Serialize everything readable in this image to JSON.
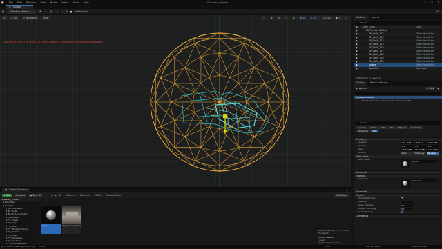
{
  "menubar": {
    "items": [
      "File",
      "Edit",
      "Window",
      "Tools",
      "Build",
      "Select",
      "Actor",
      "Help"
    ],
    "project": "Shadows_Project"
  },
  "level_tab": "FX_Funkbot",
  "toolbar": {
    "mode": "Selection Mode",
    "platforms": "Platforms"
  },
  "viewport": {
    "view": "Top",
    "shading": "Wireframe",
    "show": "Show",
    "warning": "LIGHTING NEEDS TO BE REBUILT (1 unbuilt object(s))  'DisableAllScreenMessages' to suppress",
    "grid": "10",
    "angle": "10°",
    "scale": "0.25",
    "cam": "4"
  },
  "outliner": {
    "tabs": [
      "Outliner",
      "Layers"
    ],
    "search": "Search...",
    "col_label": "Item Label",
    "col_type": "Type",
    "rows": [
      {
        "label": "FX_Funkbot (Editor)",
        "type": "",
        "sel": false
      },
      {
        "label": "SM_Walls_112",
        "type": "StaticMeshActor",
        "sel": false
      },
      {
        "label": "SM_Walls_113",
        "type": "StaticMeshActor",
        "sel": false
      },
      {
        "label": "SM_Walls_114",
        "type": "StaticMeshActor",
        "sel": false
      },
      {
        "label": "SM_Walls_115",
        "type": "StaticMeshActor",
        "sel": false
      },
      {
        "label": "SM_Walls_116",
        "type": "StaticMeshActor",
        "sel": false
      },
      {
        "label": "SM_Walls_117",
        "type": "StaticMeshActor",
        "sel": false
      },
      {
        "label": "SM_Walls_118",
        "type": "StaticMeshActor",
        "sel": false
      },
      {
        "label": "SM_Walls_119",
        "type": "StaticMeshActor",
        "sel": false
      },
      {
        "label": "SM_Walls_120",
        "type": "StaticMeshActor",
        "sel": false
      },
      {
        "label": "sphere",
        "type": "StaticMeshActor",
        "sel": true
      },
      {
        "label": "SpotLight",
        "type": "SpotLight",
        "sel": false
      }
    ],
    "footer": "1,586 actors (1 selected)"
  },
  "details": {
    "tabs": [
      "Details",
      "World Settings"
    ],
    "actor": "sphere",
    "add": "+ Add",
    "component_root": "sphere (Instance)",
    "component": "StaticMeshComponent (StaticMeshComponent0)",
    "search": "Search",
    "filter_tabs": [
      "General",
      "Actor",
      "LOD",
      "Misc",
      "Physics",
      "Rendering",
      "Streaming",
      "All"
    ],
    "cat_transform": "Transform",
    "location_label": "Location",
    "location": [
      "167.2656",
      "1978.67",
      "349.1978"
    ],
    "rotation_label": "Rotation",
    "rotation": [
      "0.0°",
      "0.0°",
      "0.0°"
    ],
    "scale_label": "Scale",
    "scale": [
      "16.263888",
      "16.263888",
      "1.78 9999"
    ],
    "mobility_label": "Mobility",
    "mobility": [
      "Static",
      "Stationary",
      "Movable"
    ],
    "cat_mesh": "Static Mesh",
    "mesh_label": "Static Mesh",
    "mesh": "Sphere",
    "cat_advanced": "Advanced",
    "cat_materials": "Materials",
    "element_label": "Element 0",
    "material": "M_Chrome",
    "cat_physics": "Physics",
    "simulate": "Simulate Physics",
    "mass": "MassInKg",
    "linear_damping": "Linear Damping",
    "angular_damping": "Angular Damping",
    "linear_val": "0.0",
    "angular_val": "0.0",
    "gravity": "Enable Gravity",
    "cat_constraints": "Constraints"
  },
  "content_browser": {
    "tab": "Content Browser",
    "add": "+ Add",
    "import": "Import",
    "save_all": "Save All",
    "path": [
      "All",
      "Content",
      "Materials",
      "CSRS",
      "Marked Effect"
    ],
    "settings": "Settings",
    "tree_root": "Shadows_Project",
    "tree": [
      "Favorites",
      "Content",
      "ArchvizDefault",
      "BP_Stuff",
      "Brush_Background",
      "Characters",
      "FX_Crowd",
      "FX_Drop",
      "FX_Dust",
      "FX_Windows_Doors",
      "FX_Holdall",
      "FX_Glass",
      "FX_ElecVentry",
      "FX_Candle_V",
      "FX_SceneWindow",
      "FX_Glitch_Actor"
    ],
    "assets": [
      {
        "name": "sphere",
        "sel": true
      },
      {
        "name": "M_preview_deploy_light_ML",
        "sel": false
      }
    ],
    "extra_top": "Selected Actor(s) in FX_Funkbot (Persistent)",
    "extra_label": "Current Content",
    "extra_level": "Level",
    "extra_level_val": "FX_Funkbot (Persistent)"
  },
  "status": {
    "drawer": "Content Drawer",
    "output": "Output Log",
    "cmd": "Cmd",
    "trace": "Trace",
    "derived": "Derived Data",
    "revision": "Source Control"
  }
}
